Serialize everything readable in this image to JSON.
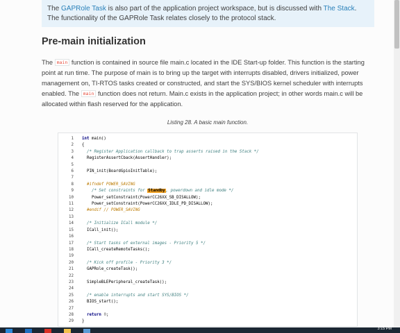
{
  "note": {
    "seg1": "The ",
    "link1": "GAPRole Task",
    "seg2": " is also part of the application project workspace, but is discussed with ",
    "link2": "The Stack",
    "seg3": ". The functionality of the GAPRole Task relates closely to the protocol stack."
  },
  "section": {
    "heading": "Pre-main initialization"
  },
  "paragraph": {
    "p1": "The ",
    "code1": "main",
    "p2": " function is contained in source file main.c located in the IDE Start-up folder. This function is the starting point at run time. The purpose of main is to bring up the target with interrupts disabled, drivers initialized, power management on, TI-RTOS tasks created or constructed, and start the SYS/BIOS kernel scheduler with interrupts enabled. The ",
    "code2": "main",
    "p3": " function does not return. Main.c exists in the application project; in other words main.c will be allocated within flash reserved for the application."
  },
  "listing": {
    "caption": "Listing 28. A basic main function.",
    "lines": [
      {
        "n": "1",
        "parts": [
          {
            "t": "int",
            "c": "kw"
          },
          {
            "t": " main()",
            "c": ""
          }
        ]
      },
      {
        "n": "2",
        "parts": [
          {
            "t": "{",
            "c": ""
          }
        ]
      },
      {
        "n": "3",
        "parts": [
          {
            "t": "  /* Register Application callback to trap asserts raised in the Stack */",
            "c": "cm"
          }
        ]
      },
      {
        "n": "4",
        "parts": [
          {
            "t": "  RegisterAssertCback(AssertHandler);",
            "c": ""
          }
        ]
      },
      {
        "n": "5",
        "parts": []
      },
      {
        "n": "6",
        "parts": [
          {
            "t": "  PIN_init(BoardGpioInitTable);",
            "c": ""
          }
        ]
      },
      {
        "n": "7",
        "parts": []
      },
      {
        "n": "8",
        "parts": [
          {
            "t": "  #ifndef POWER_SAVING",
            "c": "pp"
          }
        ]
      },
      {
        "n": "9",
        "parts": [
          {
            "t": "    /* Set constraints for ",
            "c": "cm"
          },
          {
            "t": "Standby",
            "c": "hl"
          },
          {
            "t": ", powerdown and idle mode */",
            "c": "cm"
          }
        ]
      },
      {
        "n": "10",
        "parts": [
          {
            "t": "    Power_setConstraint(PowerCC26XX_SB_DISALLOW);",
            "c": ""
          }
        ]
      },
      {
        "n": "11",
        "parts": [
          {
            "t": "    Power_setConstraint(PowerCC26XX_IDLE_PD_DISALLOW);",
            "c": ""
          }
        ]
      },
      {
        "n": "12",
        "parts": [
          {
            "t": "  #endif // POWER_SAVING",
            "c": "pp"
          }
        ]
      },
      {
        "n": "13",
        "parts": []
      },
      {
        "n": "14",
        "parts": [
          {
            "t": "  /* Initialize ICall module */",
            "c": "cm"
          }
        ]
      },
      {
        "n": "15",
        "parts": [
          {
            "t": "  ICall_init();",
            "c": ""
          }
        ]
      },
      {
        "n": "16",
        "parts": []
      },
      {
        "n": "17",
        "parts": [
          {
            "t": "  /* Start tasks of external images - Priority 5 */",
            "c": "cm"
          }
        ]
      },
      {
        "n": "18",
        "parts": [
          {
            "t": "  ICall_createRemoteTasks();",
            "c": ""
          }
        ]
      },
      {
        "n": "19",
        "parts": []
      },
      {
        "n": "20",
        "parts": [
          {
            "t": "  /* Kick off profile - Priority 3 */",
            "c": "cm"
          }
        ]
      },
      {
        "n": "21",
        "parts": [
          {
            "t": "  GAPRole_createTask();",
            "c": ""
          }
        ]
      },
      {
        "n": "22",
        "parts": []
      },
      {
        "n": "23",
        "parts": [
          {
            "t": "  SimpleBLEPeripheral_createTask();",
            "c": ""
          }
        ]
      },
      {
        "n": "24",
        "parts": []
      },
      {
        "n": "25",
        "parts": [
          {
            "t": "  /* enable interrupts and start SYS/BIOS */",
            "c": "cm"
          }
        ]
      },
      {
        "n": "26",
        "parts": [
          {
            "t": "  BIOS_start();",
            "c": ""
          }
        ]
      },
      {
        "n": "27",
        "parts": []
      },
      {
        "n": "28",
        "parts": [
          {
            "t": "  ",
            "c": ""
          },
          {
            "t": "return",
            "c": "kw"
          },
          {
            "t": " ",
            "c": ""
          },
          {
            "t": "0",
            "c": "num"
          },
          {
            "t": ";",
            "c": ""
          }
        ]
      },
      {
        "n": "29",
        "parts": [
          {
            "t": "}",
            "c": ""
          }
        ]
      }
    ]
  },
  "taskbar": {
    "clock": "3:15 PM",
    "icons": [
      {
        "name": "start-icon",
        "color": "#2b88d8"
      },
      {
        "name": "edge-icon",
        "color": "#1e6fc0"
      },
      {
        "name": "chrome-icon",
        "color": "#d93025"
      },
      {
        "name": "explorer-icon",
        "color": "#f2c04a"
      },
      {
        "name": "app-icon",
        "color": "#5a9bd5"
      }
    ]
  }
}
